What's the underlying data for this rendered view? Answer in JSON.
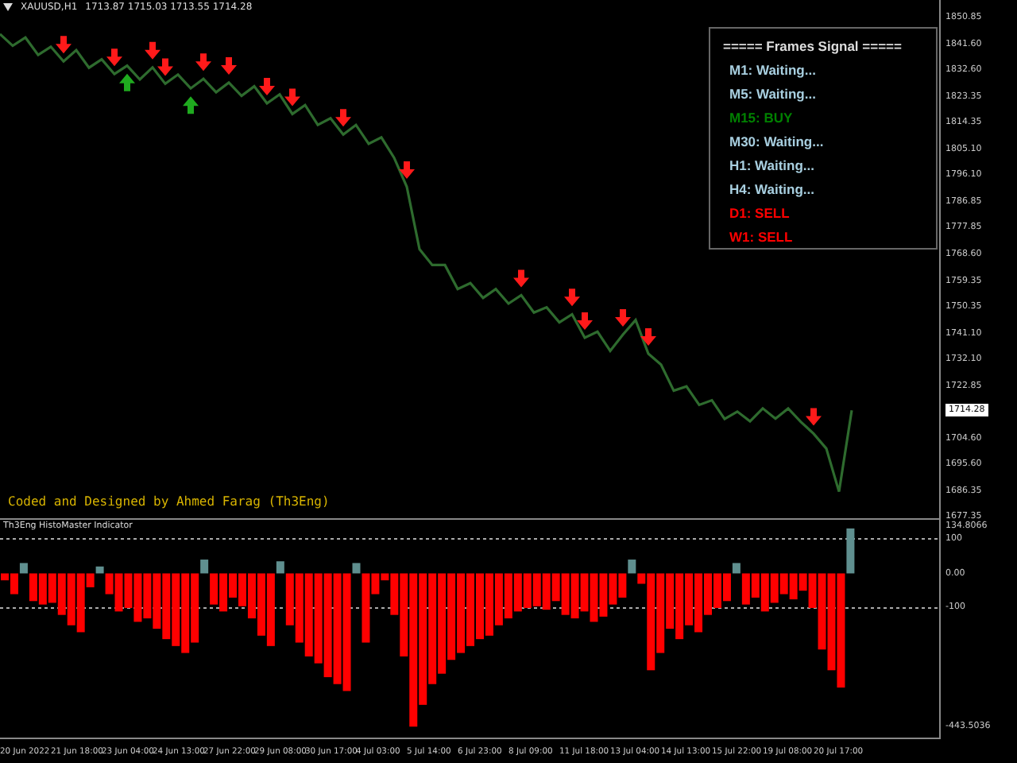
{
  "header": {
    "symbol": "XAUUSD,H1",
    "quotes": "1713.87 1715.03 1713.55 1714.28"
  },
  "signal_panel": {
    "title": "===== Frames Signal =====",
    "items": [
      {
        "label": "M1: Waiting...",
        "color": "#a8cfe0"
      },
      {
        "label": "M5: Waiting...",
        "color": "#a8cfe0"
      },
      {
        "label": "M15: BUY",
        "color": "#008000"
      },
      {
        "label": "M30: Waiting...",
        "color": "#a8cfe0"
      },
      {
        "label": "H1: Waiting...",
        "color": "#a8cfe0"
      },
      {
        "label": "H4: Waiting...",
        "color": "#a8cfe0"
      },
      {
        "label": "D1: SELL",
        "color": "#ff0000"
      },
      {
        "label": "W1: SELL",
        "color": "#ff0000"
      }
    ]
  },
  "credit": "Coded and Designed by Ahmed Farag (Th3Eng)",
  "price_chart": {
    "chart_data": {
      "type": "line",
      "ylim": [
        1676.8,
        1856.93
      ],
      "yticks": [
        {
          "value": 1850.85,
          "label": "1850.85"
        },
        {
          "value": 1841.6,
          "label": "1841.60"
        },
        {
          "value": 1832.6,
          "label": "1832.60"
        },
        {
          "value": 1823.35,
          "label": "1823.35"
        },
        {
          "value": 1814.35,
          "label": "1814.35"
        },
        {
          "value": 1805.1,
          "label": "1805.10"
        },
        {
          "value": 1796.1,
          "label": "1796.10"
        },
        {
          "value": 1786.85,
          "label": "1786.85"
        },
        {
          "value": 1777.85,
          "label": "1777.85"
        },
        {
          "value": 1768.6,
          "label": "1768.60"
        },
        {
          "value": 1759.35,
          "label": "1759.35"
        },
        {
          "value": 1750.35,
          "label": "1750.35"
        },
        {
          "value": 1741.1,
          "label": "1741.10"
        },
        {
          "value": 1732.1,
          "label": "1732.10"
        },
        {
          "value": 1722.85,
          "label": "1722.85"
        },
        {
          "value": 1704.6,
          "label": "1704.60"
        },
        {
          "value": 1695.6,
          "label": "1695.60"
        },
        {
          "value": 1686.35,
          "label": "1686.35"
        },
        {
          "value": 1677.35,
          "label": "1677.35"
        }
      ],
      "series": [
        {
          "color": "#2e6b2e",
          "values": [
            1845.1,
            1841.0,
            1843.9,
            1837.8,
            1840.7,
            1835.6,
            1839.5,
            1833.4,
            1836.3,
            1831.2,
            1834.1,
            1829.3,
            1833.5,
            1827.8,
            1831.0,
            1826.2,
            1829.5,
            1824.9,
            1828.2,
            1823.6,
            1826.9,
            1821.0,
            1824.1,
            1817.3,
            1820.4,
            1813.5,
            1815.8,
            1810.2,
            1813.5,
            1806.9,
            1809.2,
            1802.1,
            1792.0,
            1770.3,
            1764.8,
            1764.8,
            1756.5,
            1758.5,
            1753.4,
            1756.5,
            1751.4,
            1754.3,
            1748.3,
            1750.1,
            1744.9,
            1747.7,
            1739.5,
            1741.6,
            1735.0,
            1740.6,
            1745.7,
            1734.0,
            1730.2,
            1721.1,
            1722.6,
            1716.2,
            1717.8,
            1711.3,
            1713.9,
            1710.5,
            1715.0,
            1711.4,
            1714.9,
            1710.3,
            1706.2,
            1701.0,
            1686.0,
            1714.3
          ]
        }
      ]
    },
    "current_price": "1714.28"
  },
  "indicator": {
    "title": "Th3Eng HistoMaster Indicator",
    "chart_data": {
      "type": "bar",
      "ylim": [
        -470,
        155
      ],
      "yticks": [
        {
          "value": 134.8066,
          "label": "134.8066"
        },
        {
          "value": 100,
          "label": "100"
        },
        {
          "value": 0,
          "label": "0.00"
        },
        {
          "value": -100,
          "label": "-100"
        },
        {
          "value": -443.5036,
          "label": "-443.5036"
        }
      ],
      "values": [
        -20,
        -60,
        30,
        -80,
        -90,
        -85,
        -120,
        -150,
        -170,
        -40,
        20,
        -60,
        -110,
        -100,
        -140,
        -130,
        -160,
        -190,
        -210,
        -230,
        -200,
        40,
        -90,
        -110,
        -70,
        -95,
        -130,
        -180,
        -210,
        35,
        -150,
        -200,
        -240,
        -260,
        -300,
        -320,
        -340,
        30,
        -200,
        -60,
        -20,
        -120,
        -240,
        -443,
        -380,
        -320,
        -290,
        -250,
        -230,
        -210,
        -190,
        -180,
        -150,
        -130,
        -110,
        -100,
        -95,
        -105,
        -80,
        -120,
        -130,
        -110,
        -140,
        -125,
        -90,
        -70,
        40,
        -30,
        -280,
        -230,
        -160,
        -190,
        -150,
        -170,
        -120,
        -100,
        -80,
        30,
        -90,
        -70,
        -110,
        -85,
        -60,
        -75,
        -50,
        -100,
        -220,
        -280,
        -330,
        130,
        null,
        null,
        null,
        null,
        null,
        null,
        null,
        null,
        null
      ]
    }
  },
  "time_axis": [
    "20 Jun 2022",
    "21 Jun 18:00",
    "23 Jun 04:00",
    "24 Jun 13:00",
    "27 Jun 22:00",
    "29 Jun 08:00",
    "30 Jun 17:00",
    "4 Jul 03:00",
    "5 Jul 14:00",
    "6 Jul 23:00",
    "8 Jul 09:00",
    "11 Jul 18:00",
    "13 Jul 04:00",
    "14 Jul 13:00",
    "15 Jul 22:00",
    "19 Jul 08:00",
    "20 Jul 17:00"
  ]
}
